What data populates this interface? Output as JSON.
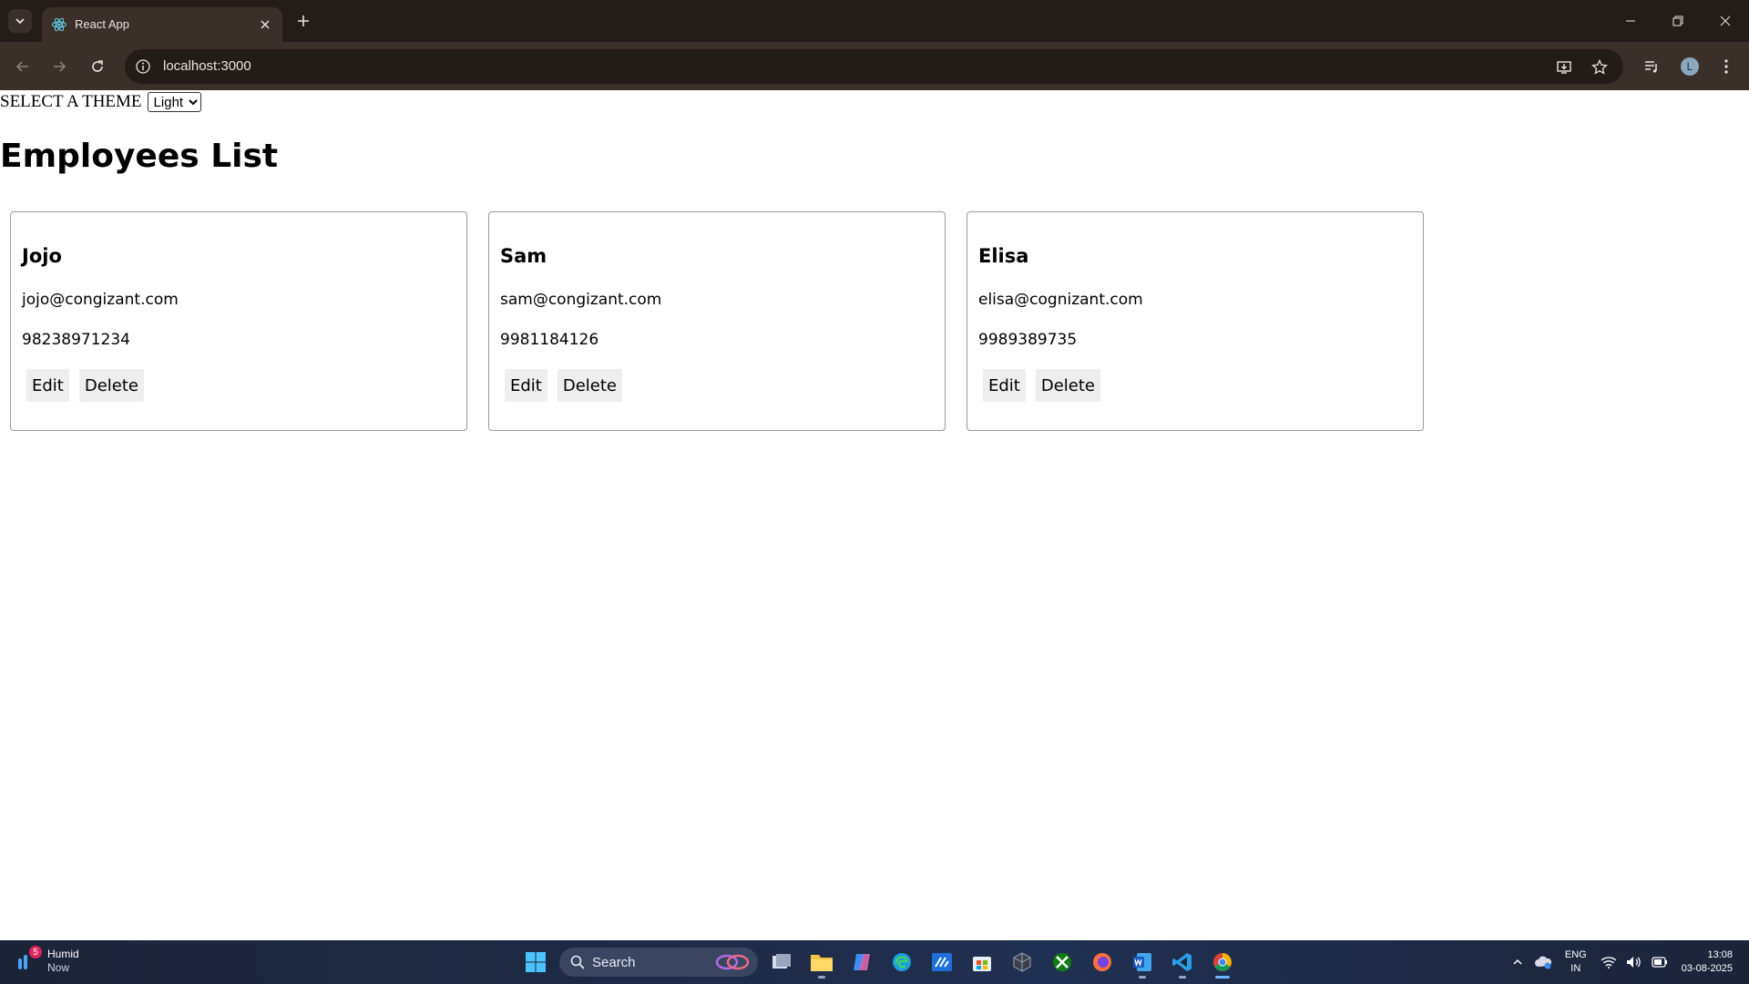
{
  "browser": {
    "tab_title": "React App",
    "url": "localhost:3000",
    "profile_initial": "L"
  },
  "page": {
    "theme_label": "SELECT A THEME",
    "theme_selected": "Light",
    "title": "Employees List",
    "employees": [
      {
        "name": "Jojo",
        "email": "jojo@congizant.com",
        "phone": "98238971234",
        "edit_label": "Edit",
        "delete_label": "Delete"
      },
      {
        "name": "Sam",
        "email": "sam@congizant.com",
        "phone": "9981184126",
        "edit_label": "Edit",
        "delete_label": "Delete"
      },
      {
        "name": "Elisa",
        "email": "elisa@cognizant.com",
        "phone": "9989389735",
        "edit_label": "Edit",
        "delete_label": "Delete"
      }
    ]
  },
  "taskbar": {
    "weather_title": "Humid",
    "weather_sub": "Now",
    "weather_badge": "5",
    "search_placeholder": "Search",
    "lang_top": "ENG",
    "lang_bottom": "IN",
    "time": "13:08",
    "date": "03-08-2025"
  },
  "colors": {
    "titlebar": "#241c18",
    "toolbar": "#3b2f29",
    "omnibox": "#231b17",
    "taskbar": "#1f2b47",
    "button_bg": "#eeeeee"
  }
}
